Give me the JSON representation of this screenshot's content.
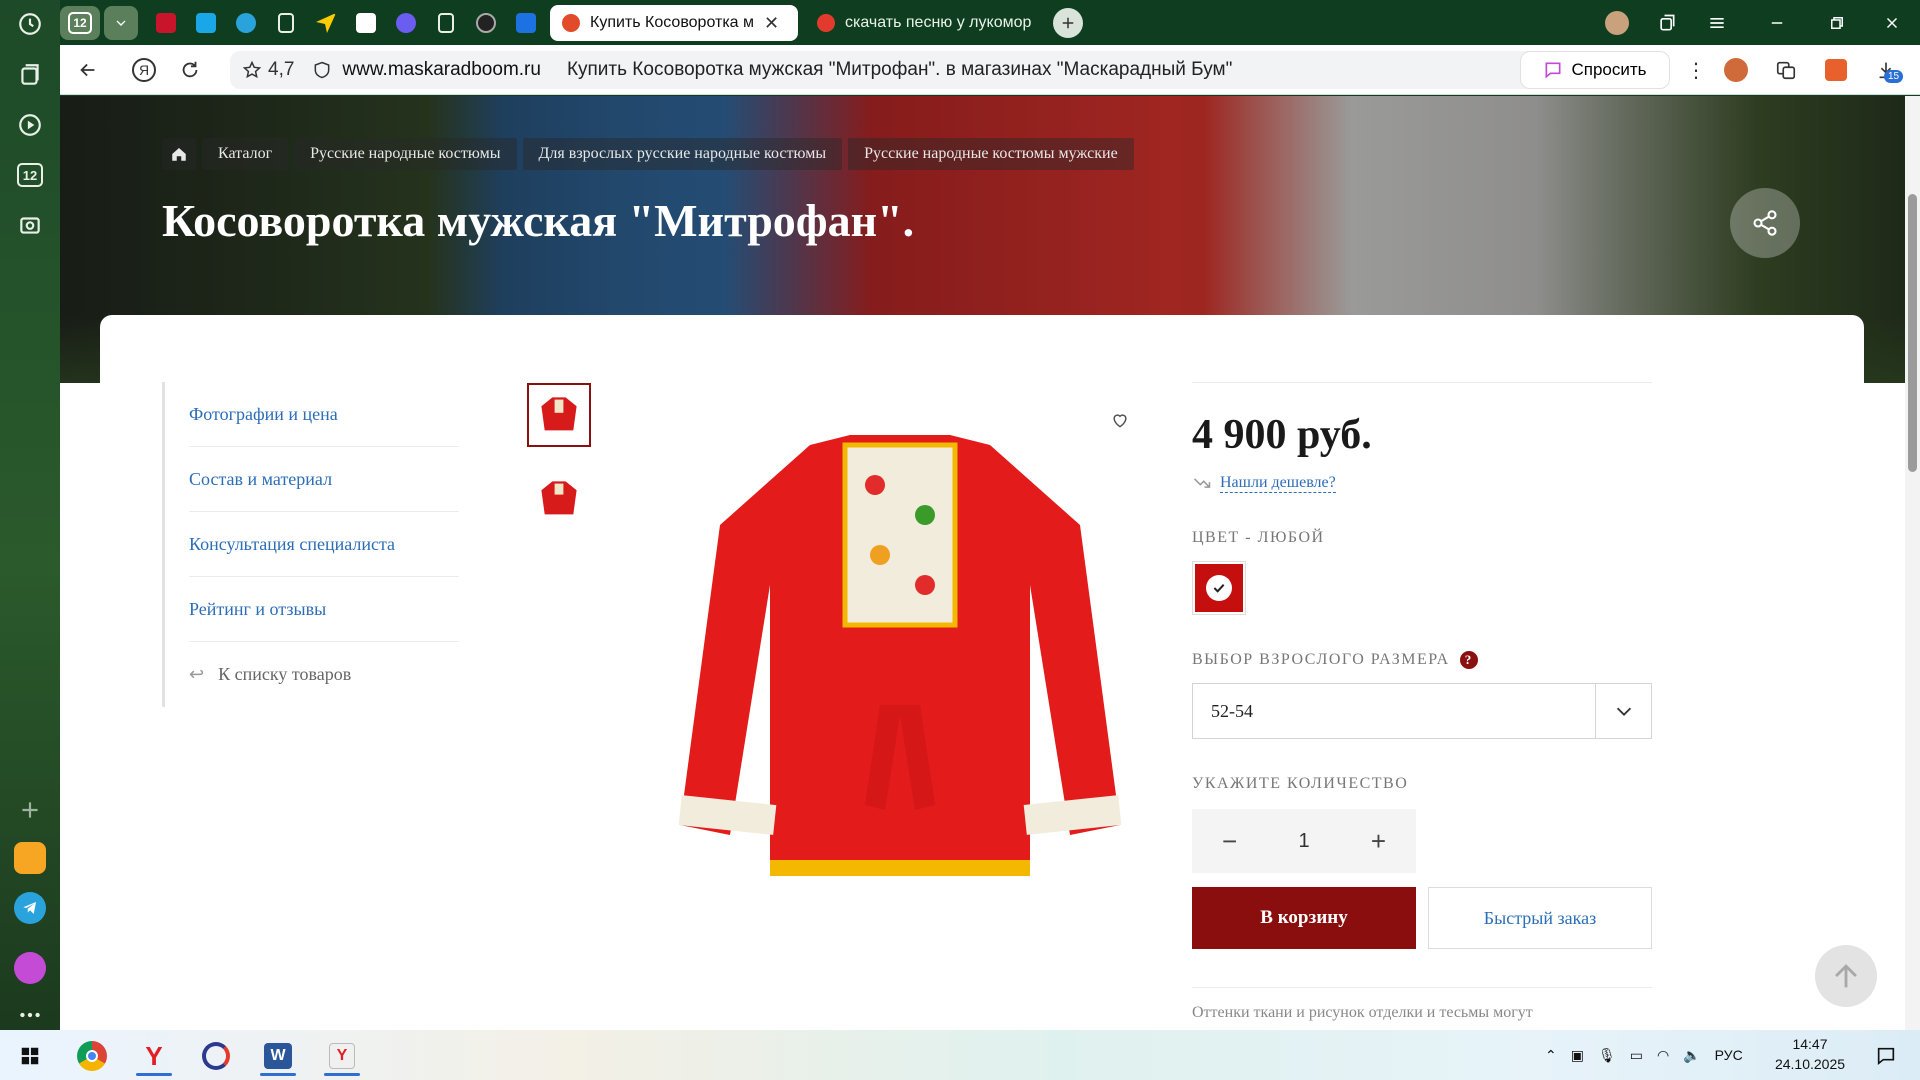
{
  "browser": {
    "tab_counter": "12",
    "tabs": [
      {
        "title": "Купить Косоворотка м",
        "active": true
      },
      {
        "title": "скачать песню у лукомор",
        "active": false
      }
    ],
    "rating": "4,7",
    "domain": "www.maskaradboom.ru",
    "page_title": "Купить Косоворотка мужская \"Митрофан\". в магазинах \"Маскарадный Бум\"",
    "ask_label": "Спросить",
    "notification_badge": "15"
  },
  "sidebar_counter": "12",
  "breadcrumb": [
    "Каталог",
    "Русские народные костюмы",
    "Для взрослых русские народные костюмы",
    "Русские народные костюмы мужские"
  ],
  "product": {
    "title": "Косоворотка мужская \"Митрофан\".",
    "price": "4 900 руб.",
    "cheaper_link": "Нашли дешевле?",
    "color_label": "ЦВЕТ - ЛЮБОЙ",
    "selected_color": "#c50f0f",
    "size_label": "ВЫБОР ВЗРОСЛОГО РАЗМЕРА",
    "size_value": "52-54",
    "qty_label": "УКАЖИТЕ КОЛИЧЕСТВО",
    "qty_value": "1",
    "add_to_cart": "В корзину",
    "quick_order": "Быстрый заказ",
    "note": "Оттенки ткани и рисунок отделки и тесьмы могут"
  },
  "side_nav": [
    "Фотографии и цена",
    "Состав и материал",
    "Консультация специалиста",
    "Рейтинг и отзывы"
  ],
  "back_link": "К списку товаров",
  "taskbar": {
    "lang": "РУС",
    "time": "14:47",
    "date": "24.10.2025"
  },
  "colors": {
    "accent": "#8b0e0e",
    "link": "#2c6db8"
  }
}
